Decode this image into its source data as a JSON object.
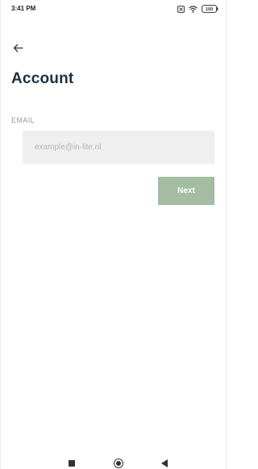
{
  "status_bar": {
    "time": "3:41 PM",
    "battery": "100"
  },
  "header": {
    "title": "Account"
  },
  "form": {
    "email_label": "EMAIL",
    "email_placeholder": "example@in-lite.nl",
    "email_value": "",
    "next_label": "Next"
  },
  "colors": {
    "title": "#1c3240",
    "next_button": "#a3bca2",
    "input_background": "#efefef"
  },
  "icons": {
    "back": "arrow-left-icon",
    "sim": "sim-card-icon",
    "wifi": "wifi-icon",
    "battery": "battery-icon",
    "nav_recents": "square-icon",
    "nav_home": "circle-icon",
    "nav_back": "triangle-back-icon"
  }
}
